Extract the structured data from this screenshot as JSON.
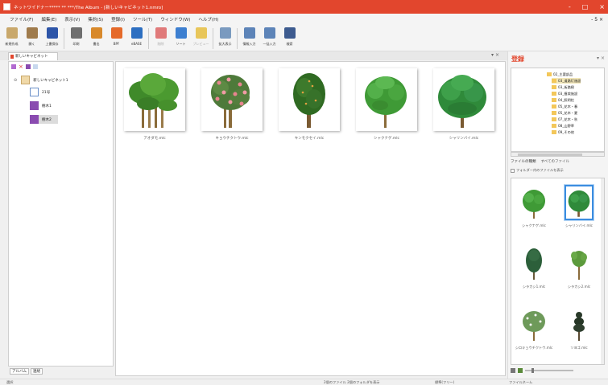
{
  "window": {
    "title": "ネットワイドナー***** ** ***/The Album - [新しいキャビネット1.nmro]",
    "controls": [
      "-",
      "□",
      "×"
    ]
  },
  "menu": {
    "items": [
      "ファイル(F)",
      "編集(E)",
      "表示(V)",
      "集約(S)",
      "登録(I)",
      "ツール(T)",
      "ウィンドウ(W)",
      "ヘルプ(H)"
    ],
    "right": "- 5 ×"
  },
  "toolbar": {
    "buttons": [
      {
        "label": "新規作成",
        "icon": "new-cabinet-icon",
        "color": "#c9a86b"
      },
      {
        "label": "開く",
        "icon": "open-icon",
        "color": "#9f7b4c"
      },
      {
        "label": "上書保存",
        "icon": "save-icon",
        "color": "#2d55a8"
      },
      {
        "label": "印刷",
        "icon": "print-icon",
        "color": "#6f6f6f"
      },
      {
        "label": "書出",
        "icon": "export-icon",
        "color": "#d8892b"
      },
      {
        "label": "BPF",
        "icon": "bpf-icon",
        "color": "#e56a2a"
      },
      {
        "label": "eBASE",
        "icon": "ebase-icon",
        "color": "#2d6fc1"
      },
      {
        "label": "削除",
        "icon": "delete-icon",
        "color": "#e07a7a"
      },
      {
        "label": "ソート",
        "icon": "sort-icon",
        "color": "#3d7fd0"
      },
      {
        "label": "プレビュー",
        "icon": "preview-icon",
        "color": "#e8c65a"
      },
      {
        "label": "拡大表示",
        "icon": "zoom-view-icon",
        "color": "#7a9abf"
      },
      {
        "label": "情報入力",
        "icon": "info-input-icon",
        "color": "#5d84b8"
      },
      {
        "label": "一括入力",
        "icon": "batch-input-icon",
        "color": "#5d84b8"
      },
      {
        "label": "検索",
        "icon": "search-icon",
        "color": "#3d5b8f"
      }
    ]
  },
  "tab": {
    "label": "新しいキャビネット1.nmro"
  },
  "tree": {
    "root": "新しいキャビネット1",
    "items": [
      "21号",
      "樹木1",
      "樹木2"
    ]
  },
  "left_tabs": [
    "アルバム",
    "連絡"
  ],
  "thumbnails": [
    {
      "label": "アオダモ.mlc"
    },
    {
      "label": "キョウチクトウ.mlc"
    },
    {
      "label": "キンモクセイ.mlc"
    },
    {
      "label": "シャクナゲ.mlc"
    },
    {
      "label": "シャリンバイ.mlc"
    }
  ],
  "right": {
    "title": "登録",
    "folders": [
      "02_主要部品",
      "03_道路灯施設",
      "03_街路樹",
      "03_植栽施設",
      "04_照明柱",
      "05_花木・春",
      "05_花木・夏",
      "07_花木・秋",
      "08_山野草",
      "09_その他"
    ],
    "selected_folder": "03_道路灯施設",
    "filter_tabs": [
      "ファイルの種類",
      "すべてのファイル"
    ],
    "checkbox_label": "フォルダー内のファイルを表示"
  },
  "grid": [
    {
      "label": "シャクナゲ.mlc",
      "selected": false
    },
    {
      "label": "シャリンバイ.mlc",
      "selected": true
    },
    {
      "label": "シラカシ1.mlc",
      "selected": false
    },
    {
      "label": "シラカシ2.mlc",
      "selected": false
    },
    {
      "label": "シロキョウチクトウ.mlc",
      "selected": false
    },
    {
      "label": "ソヨゴ.mlc",
      "selected": false
    }
  ],
  "status": {
    "left": "選択",
    "mid": "2個のファイル 2個のフォルダを表示",
    "cabinet": "標準(フリー)",
    "right": "ファイルネーム"
  }
}
